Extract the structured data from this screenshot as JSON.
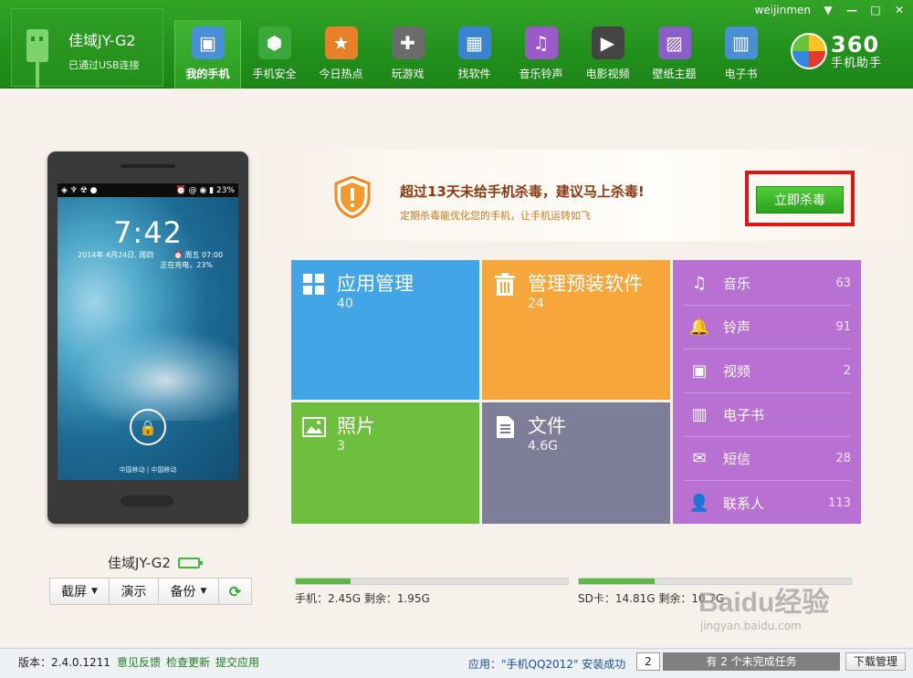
{
  "window": {
    "user": "weijinmen",
    "controls": [
      "▼",
      "—",
      "□",
      "✕"
    ]
  },
  "device": {
    "name": "佳域JY-G2",
    "connection": "已通过USB连接"
  },
  "nav": [
    {
      "label": "我的手机",
      "icon": "phone-icon",
      "color": "#4a90d9",
      "glyph": "▣",
      "active": true
    },
    {
      "label": "手机安全",
      "icon": "shield-icon",
      "color": "#3aa83a",
      "glyph": "⬢",
      "active": false
    },
    {
      "label": "今日热点",
      "icon": "star-icon",
      "color": "#e8802a",
      "glyph": "★",
      "active": false
    },
    {
      "label": "玩游戏",
      "icon": "gamepad-icon",
      "color": "#6b6b6b",
      "glyph": "✚",
      "active": false
    },
    {
      "label": "找软件",
      "icon": "apps-icon",
      "color": "#3b82d0",
      "glyph": "▦",
      "active": false
    },
    {
      "label": "音乐铃声",
      "icon": "music-icon",
      "color": "#9b59c9",
      "glyph": "♫",
      "active": false
    },
    {
      "label": "电影视频",
      "icon": "film-icon",
      "color": "#444444",
      "glyph": "▶",
      "active": false
    },
    {
      "label": "壁纸主题",
      "icon": "wallpaper-icon",
      "color": "#8a5fc9",
      "glyph": "▨",
      "active": false
    },
    {
      "label": "电子书",
      "icon": "book-icon",
      "color": "#4a8fd6",
      "glyph": "▥",
      "active": false
    }
  ],
  "logo": {
    "number": "360",
    "text": "手机助手"
  },
  "phone_screen": {
    "status_left": "◈ ♆ ☢ ●",
    "status_right": "⏰ @ ◉ ▮ 23%",
    "time": "7:42",
    "date": "2014年 4月24日, 周四",
    "alarm": "⏰ 周五 07:00",
    "charging": "正在充电，23%",
    "carrier": "中国移动 | 中国移动"
  },
  "device_label": "佳域JY-G2",
  "tools": [
    {
      "label": "截屏",
      "dropdown": true
    },
    {
      "label": "演示",
      "dropdown": false
    },
    {
      "label": "备份",
      "dropdown": true
    }
  ],
  "alert": {
    "title": "超过13天未给手机杀毒，建议马上杀毒!",
    "subtitle": "定期杀毒能优化您的手机，让手机运转如飞",
    "button": "立即杀毒"
  },
  "tiles": {
    "apps": {
      "label": "应用管理",
      "value": "40",
      "color": "#42a6e6"
    },
    "preinstalled": {
      "label": "管理预装软件",
      "value": "24",
      "color": "#f6a63b"
    },
    "photos": {
      "label": "照片",
      "value": "3",
      "color": "#6fbf3e"
    },
    "files": {
      "label": "文件",
      "value": "4.6G",
      "color": "#7e7e99"
    }
  },
  "media_list": [
    {
      "label": "音乐",
      "count": "63",
      "icon": "music-note-icon",
      "glyph": "♫"
    },
    {
      "label": "铃声",
      "count": "91",
      "icon": "bell-icon",
      "glyph": "🔔"
    },
    {
      "label": "视频",
      "count": "2",
      "icon": "video-icon",
      "glyph": "▣"
    },
    {
      "label": "电子书",
      "count": "",
      "icon": "ebook-icon",
      "glyph": "▥"
    },
    {
      "label": "短信",
      "count": "28",
      "icon": "envelope-icon",
      "glyph": "✉"
    },
    {
      "label": "联系人",
      "count": "113",
      "icon": "contact-icon",
      "glyph": "👤"
    }
  ],
  "storage": {
    "phone": {
      "text": "手机：2.45G    剩余：1.95G",
      "fill_percent": 20
    },
    "sd": {
      "text": "SD卡：14.81G    剩余：10.7G",
      "fill_percent": 28
    }
  },
  "status": {
    "version": "版本：2.4.0.1211",
    "links": [
      "意见反馈",
      "检查更新",
      "提交应用"
    ],
    "app_install": "应用：\"手机QQ2012\" 安装成功",
    "task_count": "2",
    "task_text": "有 2 个未完成任务",
    "download_manager": "下载管理"
  },
  "watermark": {
    "brand": "Baidu经验",
    "url": "jingyan.baidu.com"
  }
}
